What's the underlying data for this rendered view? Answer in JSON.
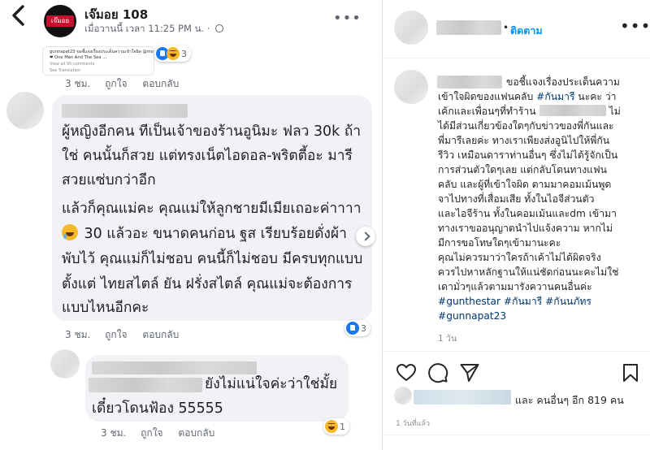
{
  "facebook": {
    "page_name": "เจ๊มอย 108",
    "post_meta": "เมื่อวานนี้ เวลา 11:25 PM น. ·",
    "page_logo_text": "เจ๊มอย",
    "shared_card": {
      "line1": "gunnapat23 ขอชี้แจงเรื่องประเด็นความเข้าใจผิด @mootono29 ∙",
      "line2": "❤ One Man And The Sea ...",
      "line3": "View all 95 comments",
      "line4": "See Translation"
    },
    "top_reactions_count": "3",
    "comments": [
      {
        "time": "3 ชม.",
        "like_label": "ถูกใจ",
        "reply_label": "ตอบกลับ"
      },
      {
        "lines": [
          "ผู้หญิงอีกคน ทีเป็นเจ้าของร้านอูนิมะ ฟลว 30k ถ้า",
          "ใช่ คนนั้นก็สวย แต่ทรงเน็ตไอดอล-พริตตี้อะ มารี",
          "สวยแซ่บกว่าอีก",
          "แล้วก็คุณแม่คะ คุณแม่ให้ลูกชายมีเมียเถอะค่าาาา",
          "30 แล้วอะ ขนาดคนก่อน ฐส เรียบร้อยดั่งผ้า",
          "พับไว้ คุณแม่ก็ไม่ชอบ คนนี้ก็ไม่ชอบ มีครบทุกแบบ",
          "ตั้งแต่ ไทยสไตล์ ยัน ฝรั่งสไตล์ คุณแม่จะต้องการ",
          "แบบไหนอีกคะ"
        ],
        "time": "3 ชม.",
        "like_label": "ถูกใจ",
        "reply_label": "ตอบกลับ",
        "reactions_count": "3"
      },
      {
        "lines": [
          "ยังไม่แน่ใจค่ะว่าใช่มั้ย",
          "เดี๋ยวโดนฟ้อง 55555"
        ],
        "time": "3 ชม.",
        "like_label": "ถูกใจ",
        "reply_label": "ตอบกลับ",
        "reactions_count": "1"
      }
    ]
  },
  "instagram": {
    "follow_label": "ติดตาม",
    "caption_lines": [
      {
        "text": "ขอชี้แจงเรื่องประเด็นความ"
      },
      {
        "text": "เข้าใจผิดของแฟนคลับ ",
        "tag": "#กันมารี",
        "rest": " นะคะ ว่า"
      },
      {
        "text": "เค้กและเพื่อนๆที่ทำร้าน",
        "rest2": "ไม่"
      },
      {
        "text": "ได้มีส่วนเกี่ยวข้องใดๆกับข่าวของพี่กันและ"
      },
      {
        "text": "พี่มารีเลยค่ะ ทางเราเพียงส่งอูนิไปให้พี่กัน"
      },
      {
        "text": "รีวิว เหมือนดาราท่านอื่นๆ ซึ่งไม่ได้รู้จักเป็น"
      },
      {
        "text": "การส่วนตัวใดๆเลย แต่กลับโดนทางแฟน"
      },
      {
        "text": "คลับ และผู้ที่เข้าใจผิด ตามมาคอมเม้นพูด"
      },
      {
        "text": "จาไปทางที่เสื่อมเสีย ทั้งในไอจีส่วนตัว"
      },
      {
        "text": "และไอจีร้าน ทั้งในคอมเม้นและdm เข้ามา"
      },
      {
        "text": "ทางเราขออนุญาตนำไปแจ้งความ หากไม่"
      },
      {
        "text": "มีการขอโทษใดๆเข้ามานะคะ"
      },
      {
        "text": "คุณไม่ควรมาว่าใครถ้าเค้าไม่ได้ผิดจริง"
      },
      {
        "text": "ควรไปหาหลักฐานให้แน่ชัดก่อนนะคะไม่ใช่"
      },
      {
        "text": "เดามั่วๆแล้วตามมารังควานคนอื่นค่ะ"
      },
      {
        "tag": "#gunthestar #กันมารี #กันนภัทร"
      },
      {
        "tag": "#gunnapat23"
      }
    ],
    "caption_time": "1 วัน",
    "likes_text": "และ คนอื่นๆ อีก 819 คน",
    "post_date": "1 วันที่แล้ว"
  },
  "colors": {
    "fb_bubble": "#f0f2f5",
    "fb_like": "#1877f2",
    "fb_haha": "#f7b928",
    "ig_link": "#0095f6",
    "ig_tag": "#00376b"
  }
}
